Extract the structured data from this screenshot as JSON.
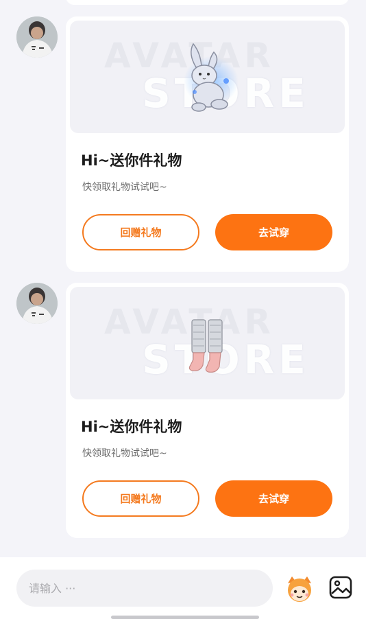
{
  "messages": [
    {
      "gift_image": "bunny-plush-icon",
      "watermark_line1": "AVATAR",
      "watermark_line2": "STORE",
      "title": "Hi~送你件礼物",
      "subtitle": "快领取礼物试试吧~",
      "return_gift_label": "回赠礼物",
      "try_on_label": "去试穿"
    },
    {
      "gift_image": "socks-icon",
      "watermark_line1": "AVATAR",
      "watermark_line2": "STORE",
      "title": "Hi~送你件礼物",
      "subtitle": "快领取礼物试试吧~",
      "return_gift_label": "回赠礼物",
      "try_on_label": "去试穿"
    }
  ],
  "composer": {
    "placeholder": "请输入 ···",
    "emoji_icon": "emoji-mascot-icon",
    "image_icon": "image-icon"
  },
  "colors": {
    "accent": "#fd7312",
    "outline": "#f47a1f",
    "background": "#f4f4f9"
  }
}
